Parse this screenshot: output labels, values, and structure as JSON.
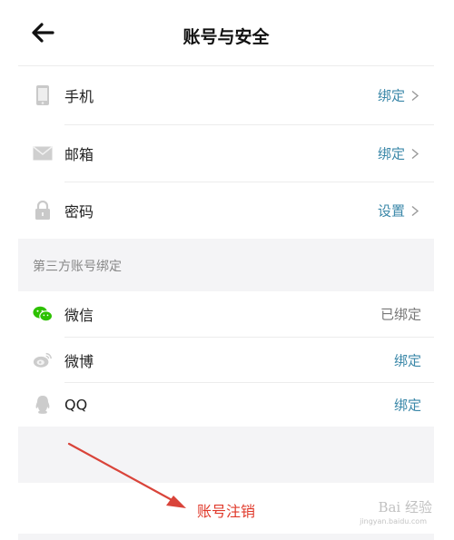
{
  "header": {
    "title": "账号与安全"
  },
  "account_rows": [
    {
      "label": "手机",
      "action": "绑定"
    },
    {
      "label": "邮箱",
      "action": "绑定"
    },
    {
      "label": "密码",
      "action": "设置"
    }
  ],
  "third_party": {
    "section_title": "第三方账号绑定",
    "rows": [
      {
        "label": "微信",
        "action": "已绑定"
      },
      {
        "label": "微博",
        "action": "绑定"
      },
      {
        "label": "QQ",
        "action": "绑定"
      }
    ]
  },
  "cancel": {
    "label": "账号注销"
  },
  "watermark": {
    "text": "Bai 经验",
    "sub": "jingyan.baidu.com"
  },
  "colors": {
    "link": "#3a87a8",
    "danger": "#e0392a",
    "arrow": "#d9443a",
    "wechat": "#2dc100"
  }
}
